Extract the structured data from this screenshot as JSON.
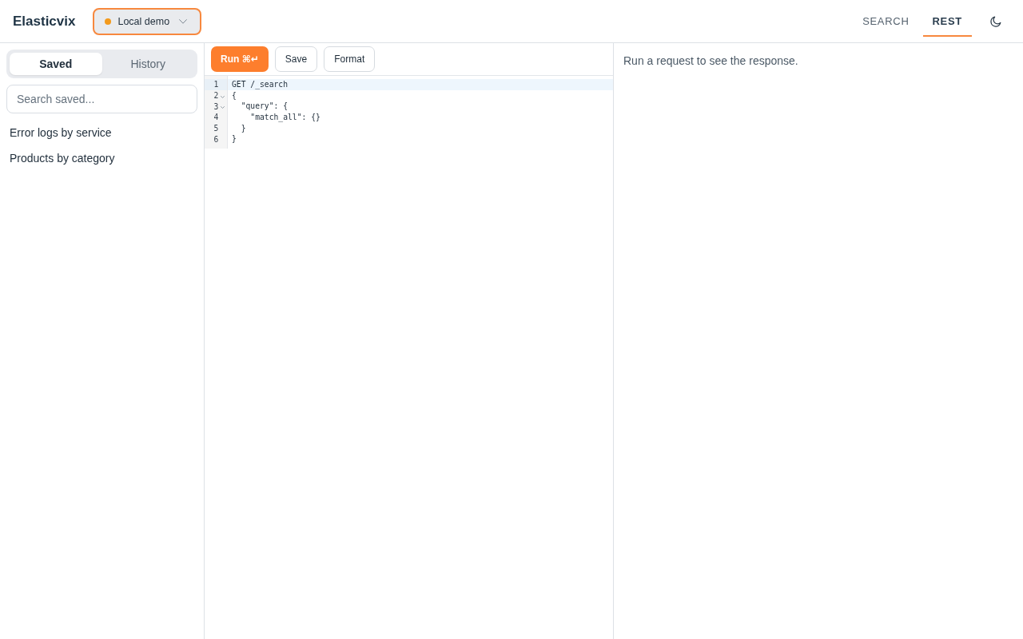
{
  "header": {
    "logo": "Elasticvix",
    "cluster": {
      "label": "Local demo"
    },
    "nav": [
      {
        "label": "SEARCH",
        "selected": false
      },
      {
        "label": "REST",
        "selected": true
      }
    ]
  },
  "sidebar": {
    "tabs": [
      {
        "label": "Saved",
        "selected": true
      },
      {
        "label": "History",
        "selected": false
      }
    ],
    "search": {
      "placeholder": "Search saved..."
    },
    "items": [
      {
        "label": "Error logs by service"
      },
      {
        "label": "Products by category"
      }
    ]
  },
  "editor": {
    "toolbar": [
      {
        "label": "Run ⌘↵",
        "kind": "primary"
      },
      {
        "label": "Save",
        "kind": "secondary"
      },
      {
        "label": "Format",
        "kind": "secondary"
      }
    ],
    "lines": [
      {
        "number": "1",
        "text": "GET /_search",
        "foldable": false,
        "active": true
      },
      {
        "number": "2",
        "text": "{",
        "foldable": true,
        "active": false
      },
      {
        "number": "3",
        "text": "  \"query\": {",
        "foldable": true,
        "active": false
      },
      {
        "number": "4",
        "text": "    \"match_all\": {}",
        "foldable": false,
        "active": false
      },
      {
        "number": "5",
        "text": "  }",
        "foldable": false,
        "active": false
      },
      {
        "number": "6",
        "text": "}",
        "foldable": false,
        "active": false
      }
    ]
  },
  "response": {
    "message": "Run a request to see the response."
  }
}
